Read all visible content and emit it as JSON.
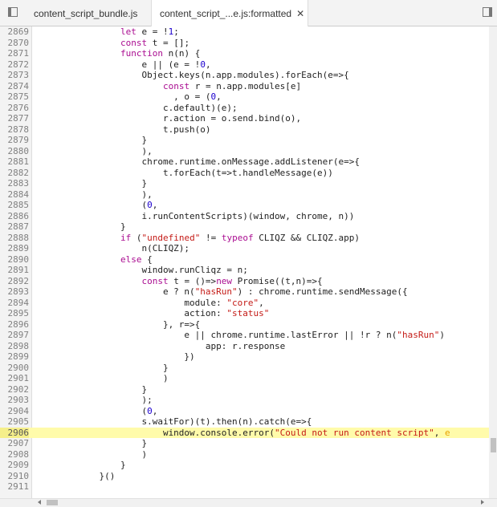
{
  "tabs": [
    {
      "label": "content_script_bundle.js"
    },
    {
      "label": "content_script_...e.js:formatted",
      "close": "✕"
    }
  ],
  "editor": {
    "highlighted_line": "2906",
    "lines": [
      {
        "n": "2869",
        "html": "                <span class=\"k\">let</span> e = !<span class=\"n\">1</span>;"
      },
      {
        "n": "2870",
        "html": "                <span class=\"k\">const</span> t = [];"
      },
      {
        "n": "2871",
        "html": "                <span class=\"k\">function</span> n(n) {"
      },
      {
        "n": "2872",
        "html": "                    e || (e = !<span class=\"n\">0</span>,"
      },
      {
        "n": "2873",
        "html": "                    Object.keys(n.app.modules).forEach(e=>{"
      },
      {
        "n": "2874",
        "html": "                        <span class=\"k\">const</span> r = n.app.modules[e]"
      },
      {
        "n": "2875",
        "html": "                          , o = (<span class=\"n\">0</span>,"
      },
      {
        "n": "2876",
        "html": "                        c.default)(e);"
      },
      {
        "n": "2877",
        "html": "                        r.action = o.send.bind(o),"
      },
      {
        "n": "2878",
        "html": "                        t.push(o)"
      },
      {
        "n": "2879",
        "html": "                    }"
      },
      {
        "n": "2880",
        "html": "                    ),"
      },
      {
        "n": "2881",
        "html": "                    chrome.runtime.onMessage.addListener(e=>{"
      },
      {
        "n": "2882",
        "html": "                        t.forEach(t=>t.handleMessage(e))"
      },
      {
        "n": "2883",
        "html": "                    }"
      },
      {
        "n": "2884",
        "html": "                    ),"
      },
      {
        "n": "2885",
        "html": "                    (<span class=\"n\">0</span>,"
      },
      {
        "n": "2886",
        "html": "                    i.runContentScripts)(window, chrome, n))"
      },
      {
        "n": "2887",
        "html": "                }"
      },
      {
        "n": "2888",
        "html": "                <span class=\"k\">if</span> (<span class=\"s\">\"undefined\"</span> != <span class=\"k\">typeof</span> CLIQZ &amp;&amp; CLIQZ.app)"
      },
      {
        "n": "2889",
        "html": "                    n(CLIQZ);"
      },
      {
        "n": "2890",
        "html": "                <span class=\"k\">else</span> {"
      },
      {
        "n": "2891",
        "html": "                    window.runCliqz = n;"
      },
      {
        "n": "2892",
        "html": "                    <span class=\"k\">const</span> t = ()=><span class=\"k\">new</span> Promise((t,n)=>{"
      },
      {
        "n": "2893",
        "html": "                        e ? n(<span class=\"s\">\"hasRun\"</span>) : chrome.runtime.sendMessage({"
      },
      {
        "n": "2894",
        "html": "                            module: <span class=\"s\">\"core\"</span>,"
      },
      {
        "n": "2895",
        "html": "                            action: <span class=\"s\">\"status\"</span>"
      },
      {
        "n": "2896",
        "html": "                        }, r=>{"
      },
      {
        "n": "2897",
        "html": "                            e || chrome.runtime.lastError || !r ? n(<span class=\"s\">\"hasRun\"</span>)"
      },
      {
        "n": "2898",
        "html": "                                app: r.response"
      },
      {
        "n": "2899",
        "html": "                            })"
      },
      {
        "n": "2900",
        "html": "                        }"
      },
      {
        "n": "2901",
        "html": "                        )"
      },
      {
        "n": "2902",
        "html": "                    }"
      },
      {
        "n": "2903",
        "html": "                    );"
      },
      {
        "n": "2904",
        "html": "                    (<span class=\"n\">0</span>,"
      },
      {
        "n": "2905",
        "html": "                    s.waitFor)(t).then(n).catch(e=>{"
      },
      {
        "n": "2906",
        "html": "                        window.console.error(<span class=\"s\">\"Could not run content script\"</span>, <span class=\"squiggle\">e</span>"
      },
      {
        "n": "2907",
        "html": "                    }"
      },
      {
        "n": "2908",
        "html": "                    )"
      },
      {
        "n": "2909",
        "html": "                }"
      },
      {
        "n": "2910",
        "html": "            }()"
      },
      {
        "n": "2911",
        "html": ""
      }
    ]
  },
  "icons": {
    "toggle_navigator": "sidebar-left-icon",
    "toggle_debugger": "sidebar-right-icon",
    "close_tab": "close-icon"
  }
}
